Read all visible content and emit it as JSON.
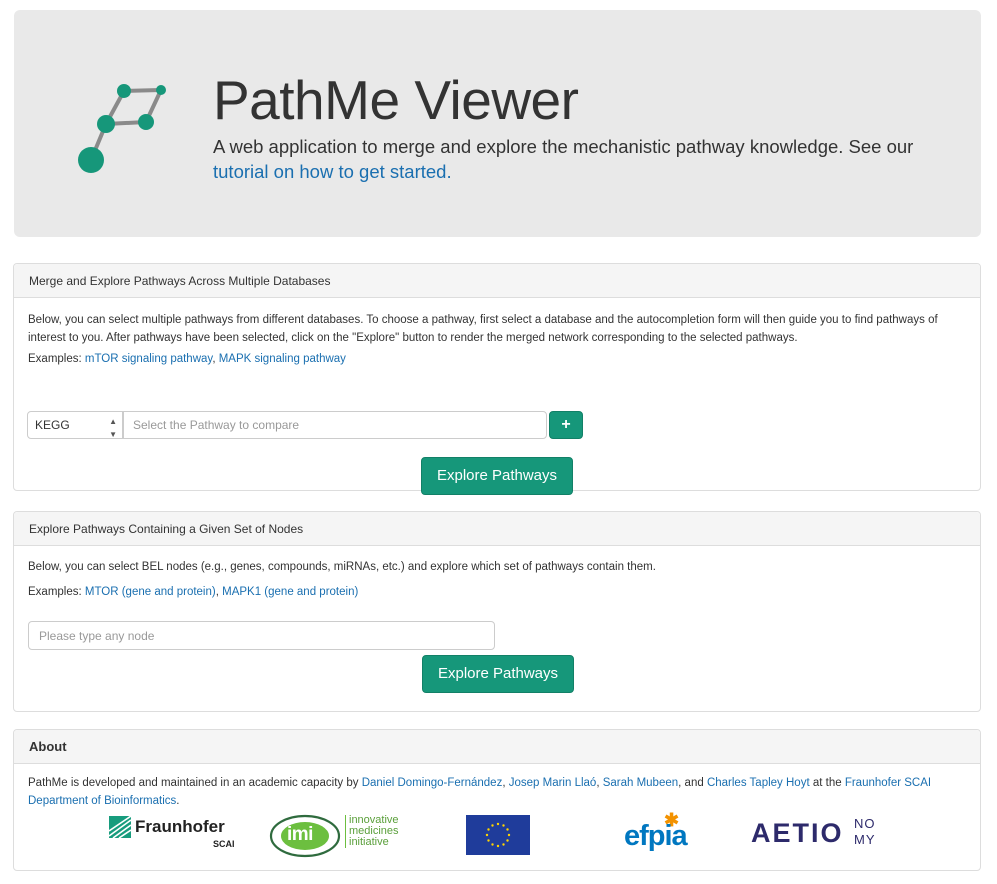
{
  "header": {
    "title": "PathMe Viewer",
    "lead_text": "A web application to merge and explore the mechanistic pathway knowledge. See our ",
    "tutorial_link": "tutorial on how to get started."
  },
  "merge_panel": {
    "heading": "Merge and Explore Pathways Across Multiple Databases",
    "description": "Below, you can select multiple pathways from different databases. To choose a pathway, first select a database and the autocompletion form will then guide you to find pathways of interest to you. After pathways have been selected, click on the \"Explore\" button to render the merged network corresponding to the selected pathways.",
    "examples_label": "Examples:",
    "examples": [
      "mTOR signaling pathway",
      "MAPK signaling pathway"
    ],
    "example_separator": ",",
    "database_selected": "KEGG",
    "pathway_placeholder": "Select the Pathway to compare",
    "add_button": "+",
    "explore_button": "Explore Pathways"
  },
  "nodes_panel": {
    "heading": "Explore Pathways Containing a Given Set of Nodes",
    "description": "Below, you can select BEL nodes (e.g., genes, compounds, miRNAs, etc.) and explore which set of pathways contain them.",
    "examples_label": "Examples:",
    "examples": [
      "MTOR (gene and protein)",
      "MAPK1 (gene and protein)"
    ],
    "example_separator": ",",
    "node_placeholder": "Please type any node",
    "explore_button": "Explore Pathways"
  },
  "about_panel": {
    "heading": "About",
    "text_before": "PathMe is developed and maintained in an academic capacity by ",
    "authors": [
      "Daniel Domingo-Fernández",
      "Josep Marin Llaó",
      "Sarah Mubeen",
      "Charles Tapley Hoyt"
    ],
    "sep1": ", ",
    "sep2": ", ",
    "sep3": ", and ",
    "text_middle": " at the ",
    "institution_link": "Fraunhofer SCAI Department of Bioinformatics",
    "text_end": ".",
    "logos": {
      "fraunhofer": {
        "name": "Fraunhofer",
        "sub": "SCAI"
      },
      "imi": {
        "mark": "imi",
        "line1": "innovative",
        "line2": "medicines",
        "line3": "initiative"
      },
      "efpia": {
        "name": "efpia"
      },
      "aetionomy": {
        "left": "AETIO",
        "top": "NO",
        "bottom": "MY"
      }
    }
  },
  "colors": {
    "brand_green": "#16977a",
    "link_blue": "#1a6fb0",
    "jumbotron_bg": "#e9e9e9",
    "eu_blue": "#1f3c9b",
    "eu_star": "#ffd400",
    "efpia_blue": "#0077c0",
    "efpia_orange": "#f39200",
    "aetionomy_navy": "#2d2a6b"
  }
}
